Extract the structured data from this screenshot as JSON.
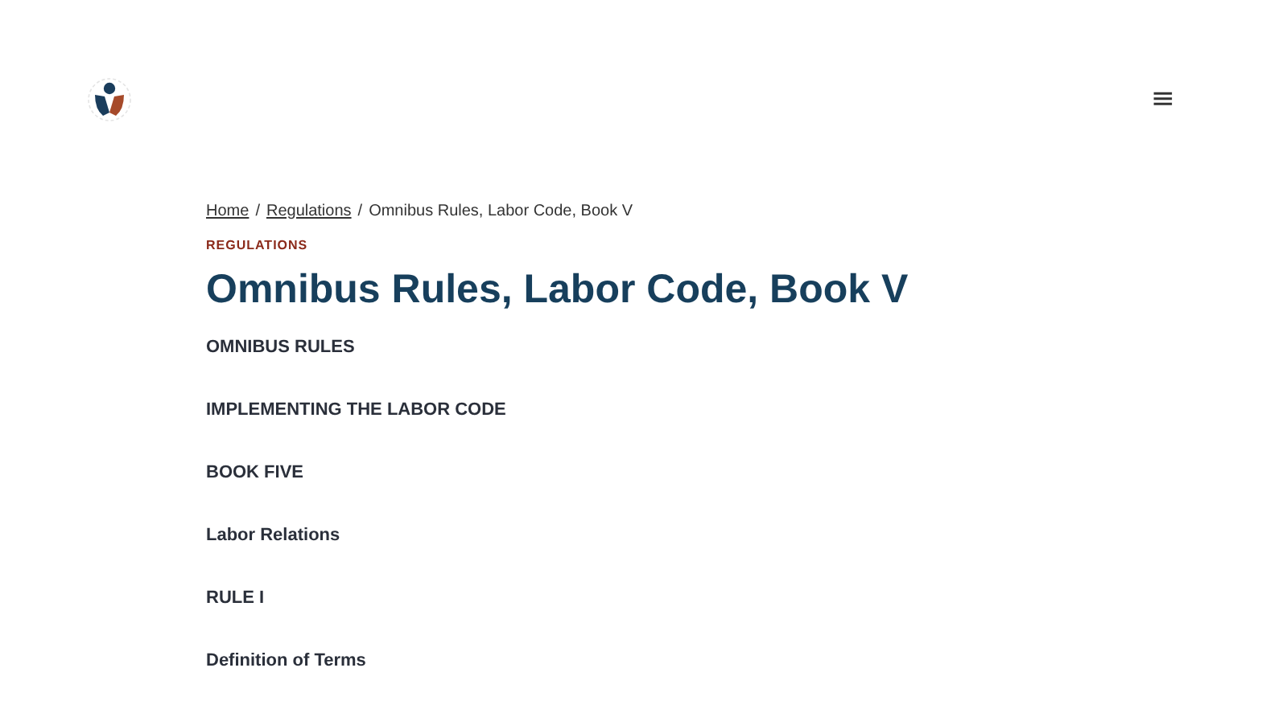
{
  "header": {
    "menu": "≡"
  },
  "breadcrumb": [
    {
      "kind": "link",
      "text": "Home"
    },
    {
      "kind": "separator",
      "text": "/"
    },
    {
      "kind": "link",
      "text": "Regulations"
    },
    {
      "kind": "separator",
      "text": "/"
    },
    {
      "kind": "current",
      "text": "Omnibus Rules, Labor Code, Book V"
    }
  ],
  "category": "REGULATIONS",
  "title": "Omnibus Rules, Labor Code, Book V",
  "sections": [
    "OMNIBUS RULES",
    "IMPLEMENTING THE LABOR CODE",
    "BOOK FIVE",
    "Labor Relations",
    "RULE I",
    "Definition of Terms"
  ]
}
